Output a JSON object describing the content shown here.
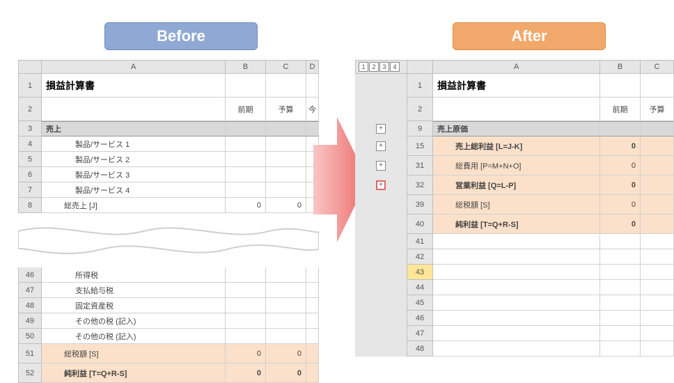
{
  "labels": {
    "before": "Before",
    "after": "After"
  },
  "cols": {
    "A": "A",
    "B": "B",
    "C": "C",
    "D": "D"
  },
  "doc_title": "損益計算書",
  "col_labels": {
    "prev": "前期",
    "budget": "予算",
    "curr": "今"
  },
  "before_rows": {
    "r1": {
      "n": "1"
    },
    "r2": {
      "n": "2"
    },
    "r3": {
      "n": "3",
      "a": "売上"
    },
    "r4": {
      "n": "4",
      "a": "製品/サービス 1"
    },
    "r5": {
      "n": "5",
      "a": "製品/サービス 2"
    },
    "r6": {
      "n": "6",
      "a": "製品/サービス 3"
    },
    "r7": {
      "n": "7",
      "a": "製品/サービス 4"
    },
    "r8": {
      "n": "8",
      "a": "総売上 [J]",
      "b": "0",
      "c": "0"
    },
    "r46": {
      "n": "46",
      "a": "所得税"
    },
    "r47": {
      "n": "47",
      "a": "支払給与税"
    },
    "r48": {
      "n": "48",
      "a": "固定資産税"
    },
    "r49": {
      "n": "49",
      "a": "その他の税 (記入)"
    },
    "r50": {
      "n": "50",
      "a": "その他の税 (記入)"
    },
    "r51": {
      "n": "51",
      "a": "総税額 [S]",
      "b": "0",
      "c": "0"
    },
    "r52": {
      "n": "52",
      "a": "純利益 [T=Q+R-S]",
      "b": "0",
      "c": "0"
    }
  },
  "outline_levels": [
    "1",
    "2",
    "3",
    "4"
  ],
  "after_rows": {
    "r1": {
      "n": "1"
    },
    "r2": {
      "n": "2"
    },
    "r9": {
      "n": "9",
      "a": "売上原価"
    },
    "r15": {
      "n": "15",
      "a": "売上総利益 [L=J-K]",
      "b": "0"
    },
    "r31": {
      "n": "31",
      "a": "総費用 [P=M+N+O]",
      "b": "0"
    },
    "r32": {
      "n": "32",
      "a": "営業利益 [Q=L-P]",
      "b": "0"
    },
    "r39": {
      "n": "39",
      "a": "総税額 [S]",
      "b": "0"
    },
    "r40": {
      "n": "40",
      "a": "純利益 [T=Q+R-S]",
      "b": "0"
    },
    "r41": {
      "n": "41"
    },
    "r42": {
      "n": "42"
    },
    "r43": {
      "n": "43"
    },
    "r44": {
      "n": "44"
    },
    "r45": {
      "n": "45"
    },
    "r46": {
      "n": "46"
    },
    "r47": {
      "n": "47"
    },
    "r48": {
      "n": "48"
    }
  }
}
